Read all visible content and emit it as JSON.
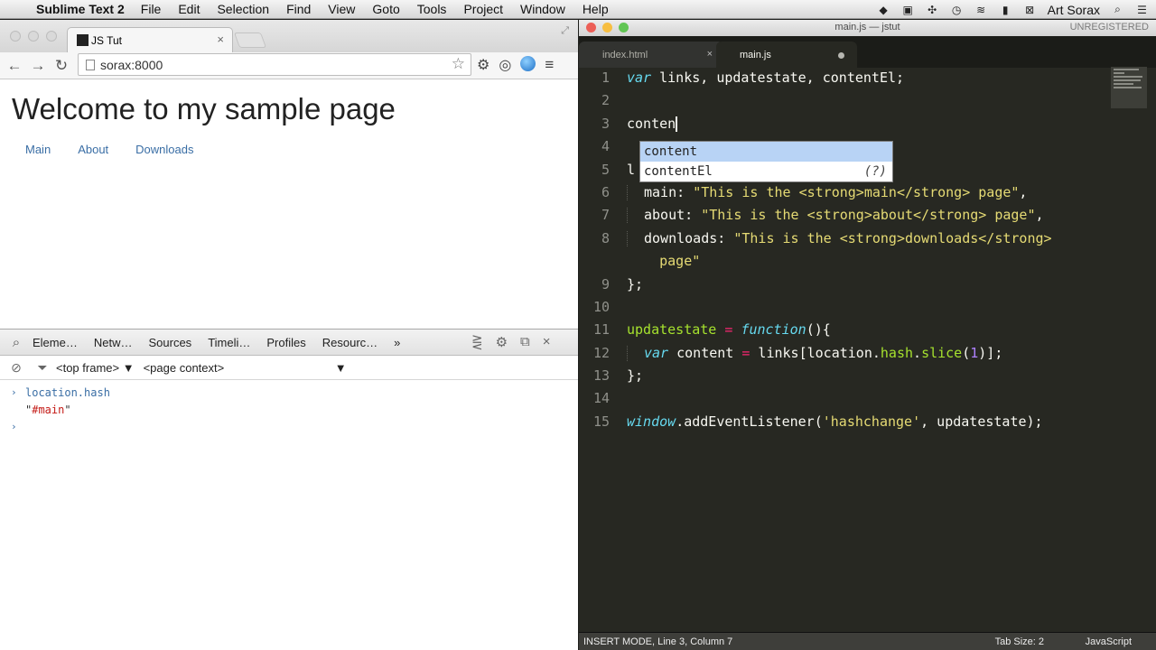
{
  "menubar": {
    "apple": "",
    "app": "Sublime Text 2",
    "items": [
      "File",
      "Edit",
      "Selection",
      "Find",
      "View",
      "Goto",
      "Tools",
      "Project",
      "Window",
      "Help"
    ],
    "user": "Art Sorax"
  },
  "browser": {
    "tab_title": "JS Tut",
    "url": "sorax:8000",
    "page": {
      "heading": "Welcome to my sample page",
      "links": [
        "Main",
        "About",
        "Downloads"
      ]
    },
    "devtools": {
      "tabs": [
        "Eleme…",
        "Netw…",
        "Sources",
        "Timeli…",
        "Profiles",
        "Resourc…"
      ],
      "more": "»",
      "frame_selector": "<top frame>",
      "context_selector": "<page context>",
      "console": {
        "command": "location.hash",
        "result": "#main",
        "quote": "\""
      }
    }
  },
  "sublime": {
    "title": "main.js — jstut",
    "unregistered": "UNREGISTERED",
    "tabs": [
      {
        "label": "index.html",
        "active": false
      },
      {
        "label": "main.js",
        "active": true
      }
    ],
    "line_numbers": [
      "1",
      "2",
      "3",
      "4",
      "5",
      "6",
      "7",
      "8",
      "",
      "9",
      "10",
      "11",
      "12",
      "13",
      "14",
      "15"
    ],
    "autocomplete": [
      {
        "label": "content",
        "hint": "",
        "selected": true
      },
      {
        "label": "contentEl",
        "hint": "(?)",
        "selected": false
      }
    ],
    "status": {
      "mode": "INSERT MODE, Line 3, Column 7",
      "tab_size": "Tab Size: 2",
      "syntax": "JavaScript"
    }
  },
  "colors": {
    "editor_bg": "#272822",
    "keyword": "#66d9ef",
    "string": "#e6db74",
    "operator": "#f92672",
    "function": "#a6e22e",
    "number": "#ae81ff"
  }
}
